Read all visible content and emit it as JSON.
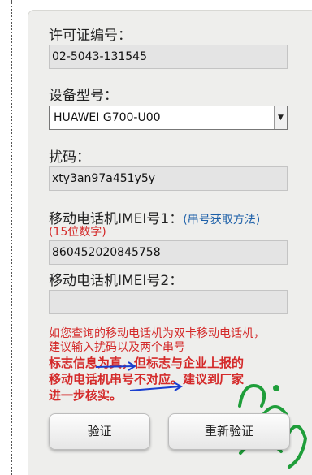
{
  "form": {
    "license_label": "许可证编号：",
    "license_value": "02-5043-131545",
    "model_label": "设备型号：",
    "model_value": "HUAWEI G700-U00",
    "code_label": "扰码：",
    "code_value": "xty3an97a451y5y",
    "imei1_label": "移动电话机IMEI号1：",
    "imei1_help_link": "(串号获取方法)",
    "imei1_note": "(15位数字)",
    "imei1_value": "860452020845758",
    "imei2_label": "移动电话机IMEI号2：",
    "imei2_value": ""
  },
  "message": {
    "dual_sim_line1": "如您查询的移动电话机为双卡移动电话机，",
    "dual_sim_line2": "建议输入扰码以及两个串号",
    "result_line1": "标志信息为真，但标志与企业上报的",
    "result_line2": "移动电话机串号不对应。建议到厂家",
    "result_line3": "进一步核实。"
  },
  "buttons": {
    "verify_label": "验证",
    "reset_label": "重新验证"
  },
  "colors": {
    "panel_bg": "#eeeeec",
    "field_bg": "#e4e4e4",
    "message_red": "#d42a2a",
    "link_blue": "#1c5fa8",
    "arrow_blue": "#1a3fd0",
    "watermark_green": "#1f9e3a"
  },
  "icons": {
    "dropdown": "chevron-down-icon",
    "annotation": "arrow-icon",
    "watermark": "arabic-calligraphy-watermark"
  }
}
